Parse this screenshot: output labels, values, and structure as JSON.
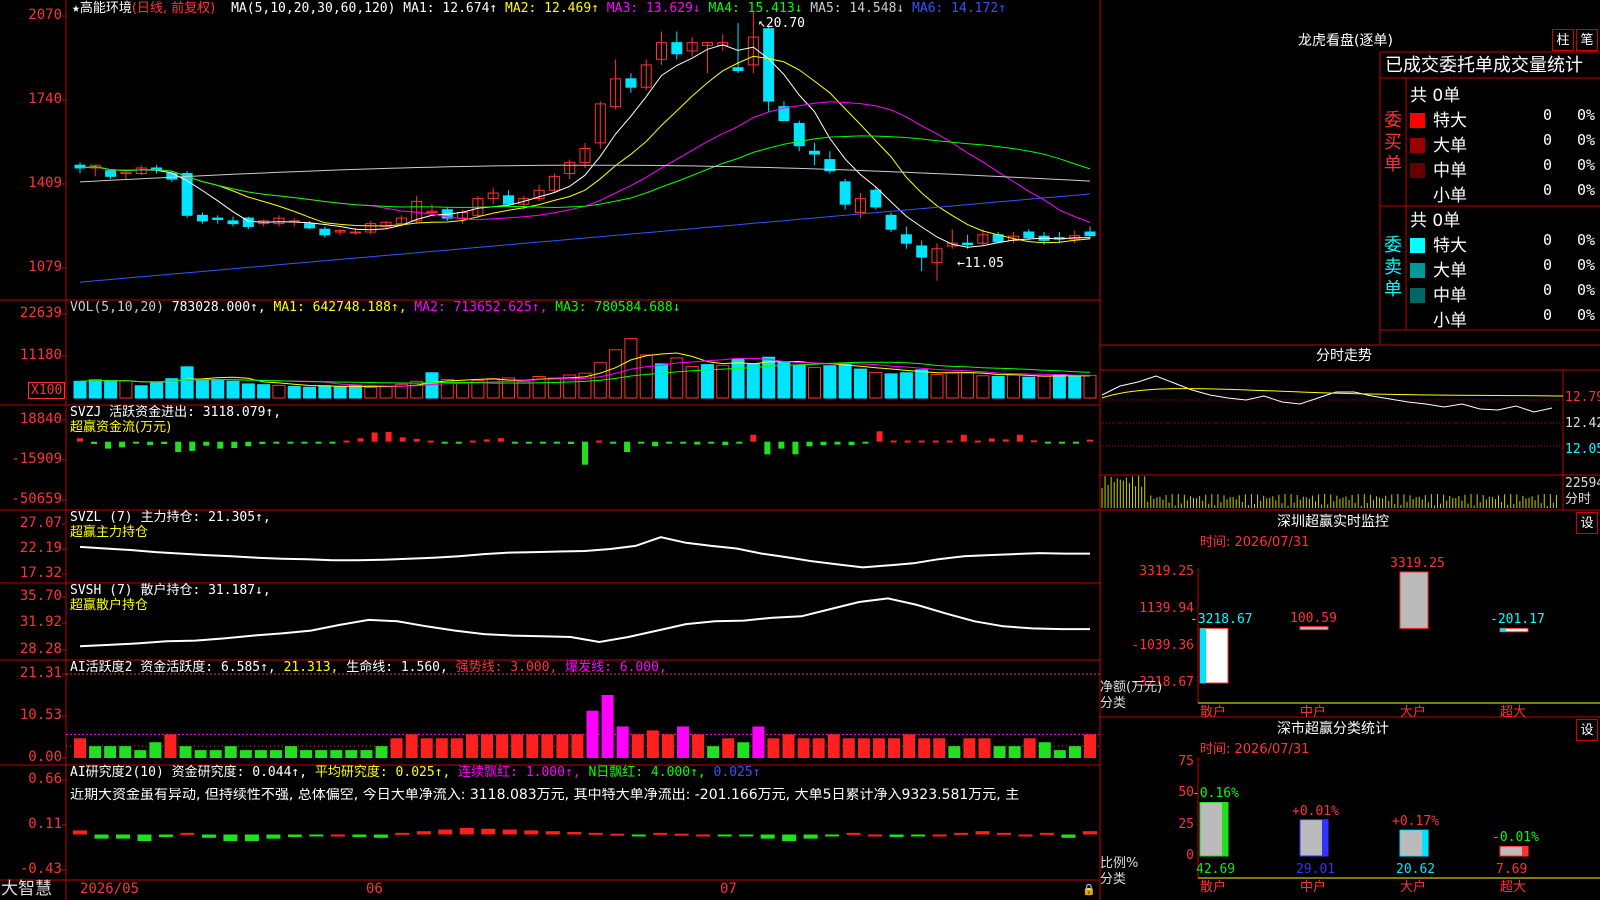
{
  "app": {
    "brand": "大智慧",
    "stock_name": "高能环境",
    "period": "(日线, 前复权)"
  },
  "price_panel": {
    "axis_ticks": [
      "2070",
      "1740",
      "1409",
      "1079"
    ],
    "ma_legend": {
      "label": "MA(5,10,20,30,60,120)",
      "items": [
        {
          "text": "MA1: 12.674",
          "arrow": "↑",
          "color": "#ffffff"
        },
        {
          "text": "MA2: 12.469",
          "arrow": "↑",
          "color": "#ffff00"
        },
        {
          "text": "MA3: 13.629",
          "arrow": "↓",
          "color": "#ff00ff"
        },
        {
          "text": "MA4: 15.413",
          "arrow": "↓",
          "color": "#00ff00"
        },
        {
          "text": "MA5: 14.548",
          "arrow": "↓",
          "color": "#cccccc"
        },
        {
          "text": "MA6: 14.172",
          "arrow": "↑",
          "color": "#3355ff"
        }
      ]
    },
    "high_mark": "20.70",
    "low_mark": "←11.05"
  },
  "vol_panel": {
    "axis_ticks": [
      "22639",
      "11180"
    ],
    "unit": "X100",
    "legend": [
      {
        "text": "VOL(5,10,20)",
        "color": "#cccccc"
      },
      {
        "text": "783028.000↑,",
        "color": "#ffffff"
      },
      {
        "text": "MA1: 642748.188↑,",
        "color": "#ffff00"
      },
      {
        "text": "MA2: 713652.625↑,",
        "color": "#ff00ff"
      },
      {
        "text": "MA3: 780584.688↓",
        "color": "#00ff00"
      }
    ]
  },
  "svzj_panel": {
    "axis_ticks": [
      "18840",
      "-15909",
      "-50659"
    ],
    "line1": "SVZJ  活跃资金进出: 3118.079↑,",
    "line2": "超赢资金流(万元)"
  },
  "svzl_panel": {
    "axis_ticks": [
      "27.07",
      "22.19",
      "17.32"
    ],
    "line1": "SVZL (7) 主力持仓: 21.305↑,",
    "line2": "超赢主力持仓"
  },
  "svsh_panel": {
    "axis_ticks": [
      "35.70",
      "31.92",
      "28.28"
    ],
    "line1": "SVSH (7) 散户持仓: 31.187↓,",
    "line2": "超赢散户持仓"
  },
  "ai_active": {
    "axis_ticks": [
      "21.31",
      "10.53",
      "0.00"
    ],
    "legend": [
      {
        "text": "AI活跃度2 资金活跃度: 6.585↑,",
        "color": "#ffffff"
      },
      {
        "text": "21.313,",
        "color": "#ffff00"
      },
      {
        "text": "生命线: 1.560,",
        "color": "#ffffff"
      },
      {
        "text": "强势线: 3.000,",
        "color": "#ff3333"
      },
      {
        "text": "爆发线: 6.000,",
        "color": "#ff00ff"
      }
    ]
  },
  "ai_research": {
    "axis_ticks": [
      "0.66",
      "0.11",
      "-0.43"
    ],
    "legend": [
      {
        "text": "AI研究度2(10) 资金研究度: 0.044↑,",
        "color": "#ffffff"
      },
      {
        "text": "平均研究度: 0.025↑,",
        "color": "#ffff00"
      },
      {
        "text": "连续飘红: 1.000↑,",
        "color": "#ff00ff"
      },
      {
        "text": "N日飘红: 4.000↑,",
        "color": "#00ff00"
      },
      {
        "text": "0.025↑",
        "color": "#3355ff"
      }
    ],
    "comment": "近期大资金虽有异动, 但持续性不强, 总体偏空, 今日大单净流入: 3118.083万元, 其中特大单净流出: -201.166万元, 大单5日累计净入9323.581万元, 主"
  },
  "x_axis": {
    "labels": [
      "2026/05",
      "06",
      "07"
    ]
  },
  "longhu": {
    "title": "龙虎看盘(逐单)",
    "btn1": "柱",
    "btn2": "笔",
    "header": "已成交委托单成交量统计",
    "buy_label": "委买单",
    "sell_label": "委卖单",
    "buy_total": "共 0单",
    "sell_total": "共 0单",
    "buy_rows": [
      {
        "name": "特大",
        "val": "0",
        "pct": "0%",
        "color": "#ff0000"
      },
      {
        "name": "大单",
        "val": "0",
        "pct": "0%",
        "color": "#990000"
      },
      {
        "name": "中单",
        "val": "0",
        "pct": "0%",
        "color": "#660000"
      },
      {
        "name": "小单",
        "val": "0",
        "pct": "0%",
        "color": "#000000"
      }
    ],
    "sell_rows": [
      {
        "name": "特大",
        "val": "0",
        "pct": "0%",
        "color": "#00ffff"
      },
      {
        "name": "大单",
        "val": "0",
        "pct": "0%",
        "color": "#009999"
      },
      {
        "name": "中单",
        "val": "0",
        "pct": "0%",
        "color": "#006666"
      },
      {
        "name": "小单",
        "val": "0",
        "pct": "0%",
        "color": "#000000"
      }
    ]
  },
  "intraday": {
    "title": "分时走势",
    "price_ticks": [
      "12.79",
      "12.42",
      "12.05"
    ],
    "vol_tick": "22594",
    "vol_label": "分时"
  },
  "sz_monitor": {
    "title": "深圳超赢实时监控",
    "set": "设",
    "time": "时间: 2026/07/31",
    "axis_ticks": [
      "3319.25",
      "1139.94",
      "-1039.36",
      "-3218.67"
    ],
    "unit_line1": "净额(万元)",
    "unit_line2": "分类",
    "bars": [
      {
        "cat": "散户",
        "value": -3218.67,
        "label": "-3218.67"
      },
      {
        "cat": "中户",
        "value": 100.59,
        "label": "100.59"
      },
      {
        "cat": "大户",
        "value": 3319.25,
        "label": "3319.25"
      },
      {
        "cat": "超大",
        "value": -201.17,
        "label": "-201.17"
      }
    ]
  },
  "sz_classify": {
    "title": "深市超赢分类统计",
    "set": "设",
    "time": "时间: 2026/07/31",
    "axis_ticks": [
      "75",
      "50",
      "25",
      "0"
    ],
    "unit_line1": "比例%",
    "unit_line2": "分类",
    "bars": [
      {
        "cat": "散户",
        "value": 42.69,
        "label": "42.69",
        "delta": "-0.16%"
      },
      {
        "cat": "中户",
        "value": 29.01,
        "label": "29.01",
        "delta": "+0.01%"
      },
      {
        "cat": "大户",
        "value": 20.62,
        "label": "20.62",
        "delta": "+0.17%"
      },
      {
        "cat": "超大",
        "value": 7.69,
        "label": "7.69",
        "delta": "-0.01%"
      }
    ]
  },
  "chart_data": [
    {
      "type": "candlestick",
      "title": "高能环境 (日线, 前复权)",
      "ohlc": [
        [
          15.2,
          15.3,
          14.9,
          15.1
        ],
        [
          15.1,
          15.2,
          14.8,
          15.2
        ],
        [
          15.0,
          15.05,
          14.7,
          14.8
        ],
        [
          14.9,
          15.0,
          14.7,
          14.95
        ],
        [
          14.9,
          15.2,
          14.85,
          15.1
        ],
        [
          15.1,
          15.2,
          14.9,
          15.05
        ],
        [
          14.9,
          15.0,
          14.6,
          14.7
        ],
        [
          14.9,
          15.0,
          13.3,
          13.4
        ],
        [
          13.4,
          13.5,
          13.1,
          13.2
        ],
        [
          13.3,
          13.4,
          13.1,
          13.25
        ],
        [
          13.2,
          13.35,
          13.0,
          13.1
        ],
        [
          13.3,
          13.35,
          12.9,
          13.0
        ],
        [
          13.1,
          13.25,
          13.0,
          13.2
        ],
        [
          13.1,
          13.4,
          13.0,
          13.3
        ],
        [
          13.2,
          13.3,
          13.0,
          13.2
        ],
        [
          13.1,
          13.2,
          12.9,
          12.95
        ],
        [
          12.9,
          13.0,
          12.6,
          12.7
        ],
        [
          12.8,
          12.9,
          12.7,
          12.85
        ],
        [
          12.8,
          12.95,
          12.7,
          12.8
        ],
        [
          12.8,
          13.2,
          12.7,
          13.1
        ],
        [
          13.0,
          13.2,
          12.9,
          13.15
        ],
        [
          13.1,
          13.4,
          13.0,
          13.3
        ],
        [
          13.2,
          14.1,
          13.1,
          13.9
        ],
        [
          13.5,
          13.8,
          13.4,
          13.55
        ],
        [
          13.6,
          13.7,
          13.2,
          13.3
        ],
        [
          13.3,
          13.6,
          13.1,
          13.5
        ],
        [
          13.4,
          14.1,
          13.3,
          14.0
        ],
        [
          14.0,
          14.4,
          13.8,
          14.2
        ],
        [
          14.1,
          14.3,
          13.7,
          13.8
        ],
        [
          13.8,
          14.1,
          13.6,
          14.0
        ],
        [
          14.0,
          14.5,
          13.9,
          14.3
        ],
        [
          14.3,
          14.9,
          14.2,
          14.8
        ],
        [
          14.9,
          15.4,
          14.7,
          15.3
        ],
        [
          15.3,
          16.0,
          15.1,
          15.8
        ],
        [
          16.0,
          17.5,
          15.8,
          17.4
        ],
        [
          17.3,
          19.0,
          17.2,
          18.3
        ],
        [
          18.3,
          18.5,
          17.8,
          18.0
        ],
        [
          18.0,
          19.0,
          17.9,
          18.8
        ],
        [
          19.0,
          20.0,
          18.8,
          19.6
        ],
        [
          19.6,
          20.0,
          19.0,
          19.2
        ],
        [
          19.3,
          19.8,
          19.1,
          19.6
        ],
        [
          19.5,
          19.6,
          18.5,
          19.6
        ],
        [
          19.5,
          19.9,
          19.3,
          19.6
        ],
        [
          18.7,
          20.3,
          18.5,
          18.6
        ],
        [
          18.8,
          20.7,
          18.5,
          19.8
        ],
        [
          20.1,
          20.2,
          17.1,
          17.5
        ],
        [
          17.3,
          17.5,
          16.8,
          16.8
        ],
        [
          16.7,
          16.8,
          15.7,
          15.9
        ],
        [
          15.7,
          16.0,
          15.2,
          15.6
        ],
        [
          15.4,
          15.7,
          14.9,
          15.0
        ],
        [
          14.6,
          14.7,
          13.6,
          13.8
        ],
        [
          13.5,
          14.2,
          13.3,
          14.0
        ],
        [
          14.3,
          14.4,
          13.6,
          13.7
        ],
        [
          13.4,
          13.5,
          12.8,
          12.9
        ],
        [
          12.7,
          13.0,
          12.2,
          12.4
        ],
        [
          12.3,
          12.5,
          11.4,
          11.9
        ],
        [
          11.7,
          12.4,
          11.05,
          12.2
        ],
        [
          12.3,
          12.9,
          12.2,
          12.4
        ],
        [
          12.4,
          12.7,
          12.2,
          12.35
        ],
        [
          12.4,
          12.9,
          12.3,
          12.7
        ],
        [
          12.7,
          12.8,
          12.4,
          12.45
        ],
        [
          12.5,
          12.8,
          12.4,
          12.65
        ],
        [
          12.8,
          12.9,
          12.5,
          12.6
        ],
        [
          12.65,
          12.8,
          12.35,
          12.5
        ],
        [
          12.6,
          12.8,
          12.4,
          12.55
        ],
        [
          12.55,
          12.85,
          12.4,
          12.67
        ],
        [
          12.8,
          13.0,
          12.55,
          12.67
        ]
      ],
      "ylim": [
        10.79,
        20.7
      ],
      "high": 20.7,
      "low": 11.05
    },
    {
      "type": "bar",
      "title": "VOL(5,10,20)",
      "values": [
        4500,
        4900,
        4700,
        4600,
        3300,
        4100,
        5200,
        8400,
        4800,
        5000,
        4500,
        3800,
        3600,
        3400,
        3100,
        2900,
        3300,
        3000,
        3300,
        2900,
        3000,
        3700,
        4500,
        6800,
        5000,
        4000,
        4700,
        5200,
        5400,
        4400,
        5800,
        5400,
        6200,
        6700,
        9500,
        13000,
        16000,
        11600,
        9200,
        10800,
        8500,
        9000,
        8800,
        10500,
        9300,
        11000,
        9600,
        8800,
        8200,
        8700,
        9200,
        7800,
        6900,
        6500,
        6800,
        7600,
        6300,
        6800,
        6800,
        6000,
        5800,
        6200,
        5600,
        5900,
        6300,
        5900,
        6100
      ],
      "colors": [
        "c",
        "c",
        "c",
        "r",
        "c",
        "c",
        "c",
        "c",
        "c",
        "c",
        "c",
        "c",
        "c",
        "r",
        "c",
        "c",
        "c",
        "c",
        "c",
        "r",
        "r",
        "r",
        "r",
        "c",
        "r",
        "r",
        "r",
        "r",
        "r",
        "r",
        "r",
        "r",
        "r",
        "r",
        "r",
        "r",
        "r",
        "r",
        "c",
        "r",
        "r",
        "c",
        "r",
        "c",
        "c",
        "c",
        "c",
        "c",
        "r",
        "c",
        "c",
        "c",
        "r",
        "c",
        "c",
        "c",
        "r",
        "r",
        "r",
        "r",
        "c",
        "r",
        "c",
        "r",
        "c",
        "c",
        "r"
      ],
      "ylim": [
        0,
        22639
      ],
      "unit": "X100"
    },
    {
      "type": "bar",
      "title": "SVZJ 活跃资金进出",
      "values": [
        3000,
        -2000,
        -6000,
        -5000,
        -1500,
        -3000,
        -2000,
        -9000,
        -8000,
        -3500,
        -6000,
        -5500,
        -4000,
        -2000,
        -1000,
        -1000,
        -1000,
        -700,
        -400,
        1000,
        3000,
        8000,
        8500,
        3800,
        2500,
        1000,
        -1000,
        -500,
        1000,
        2000,
        3000,
        -1000,
        -200,
        -200,
        -1500,
        -2000,
        -20000,
        1000,
        -1000,
        -9000,
        -1000,
        -4000,
        -1000,
        -1000,
        -2500,
        -1000,
        -3000,
        -1000,
        6000,
        -11000,
        -6000,
        -11000,
        -4000,
        -3000,
        -2500,
        -3000,
        -1000,
        9000,
        1000,
        1000,
        1000,
        1000,
        1000,
        6000,
        1000,
        2800,
        2000,
        6000,
        1200,
        -1500,
        -1500,
        -1500,
        1800
      ],
      "ylim": [
        -50659,
        18840
      ]
    },
    {
      "type": "line",
      "title": "SVZL 主力持仓",
      "values": [
        22.6,
        22.3,
        22.0,
        21.6,
        21.3,
        21.0,
        20.8,
        20.5,
        20.3,
        20.2,
        20.0,
        20.0,
        20.1,
        20.3,
        20.5,
        20.8,
        21.2,
        21.5,
        21.6,
        21.7,
        21.8,
        22.2,
        22.8,
        24.5,
        23.4,
        22.8,
        22.3,
        21.3,
        20.6,
        19.8,
        19.2,
        18.6,
        19.0,
        19.4,
        20.2,
        20.8,
        21.0,
        21.2,
        21.4,
        21.3,
        21.3
      ],
      "ylim": [
        17.32,
        27.07
      ]
    },
    {
      "type": "line",
      "title": "SVSH 散户持仓",
      "values": [
        28.8,
        29.0,
        29.2,
        29.5,
        29.6,
        29.9,
        30.3,
        30.6,
        31.0,
        31.8,
        32.5,
        32.3,
        31.6,
        31.0,
        30.5,
        30.3,
        30.2,
        30.1,
        29.4,
        30.1,
        31.0,
        31.9,
        32.3,
        32.4,
        32.8,
        33.0,
        34.0,
        35.0,
        35.5,
        34.6,
        33.4,
        32.3,
        31.6,
        31.3,
        31.2,
        31.2
      ],
      "ylim": [
        28.28,
        35.7
      ]
    },
    {
      "type": "bar",
      "title": "AI活跃度2 资金活跃度",
      "values": [
        5,
        3,
        3,
        3,
        2,
        4,
        6,
        3,
        2,
        2,
        3,
        2,
        2,
        2,
        3,
        2,
        2,
        2,
        2,
        2,
        3,
        5,
        6,
        5,
        5,
        5,
        6,
        6,
        6,
        6,
        6,
        6,
        6,
        6,
        12,
        16,
        8,
        6,
        7,
        6,
        8,
        6,
        3,
        5,
        4,
        8,
        5,
        6,
        5,
        5,
        6,
        5,
        5,
        5,
        5,
        6,
        5,
        5,
        3,
        5,
        5,
        3,
        3,
        5,
        4,
        2,
        3,
        6
      ],
      "ylim": [
        0,
        21.31
      ]
    },
    {
      "type": "bar",
      "title": "AI研究度2(10) 资金研究度",
      "values": [
        0.05,
        -0.05,
        -0.05,
        -0.08,
        -0.03,
        0.02,
        -0.04,
        -0.08,
        -0.08,
        -0.05,
        -0.03,
        -0.01,
        0.0,
        -0.03,
        -0.04,
        0.02,
        0.04,
        0.06,
        0.08,
        0.07,
        0.06,
        0.05,
        0.04,
        0.03,
        0.02,
        0.01,
        -0.02,
        0.02,
        0.01,
        0.0,
        -0.01,
        -0.02,
        -0.05,
        -0.08,
        -0.05,
        -0.02,
        0.02,
        0.0,
        -0.03,
        -0.02,
        0.0,
        0.02,
        0.04,
        0.02,
        0.0,
        0.02,
        -0.04,
        0.04
      ],
      "ylim": [
        -0.43,
        0.66
      ]
    },
    {
      "type": "bar",
      "title": "深圳超赢实时监控",
      "categories": [
        "散户",
        "中户",
        "大户",
        "超大"
      ],
      "values": [
        -3218.67,
        100.59,
        3319.25,
        -201.17
      ],
      "ylim": [
        -3218.67,
        3319.25
      ],
      "ylabel": "净额(万元)",
      "xlabel": "分类"
    },
    {
      "type": "bar",
      "title": "深市超赢分类统计",
      "categories": [
        "散户",
        "中户",
        "大户",
        "超大"
      ],
      "values": [
        42.69,
        29.01,
        20.62,
        7.69
      ],
      "ylim": [
        0,
        75
      ],
      "ylabel": "比例%",
      "xlabel": "分类"
    }
  ]
}
